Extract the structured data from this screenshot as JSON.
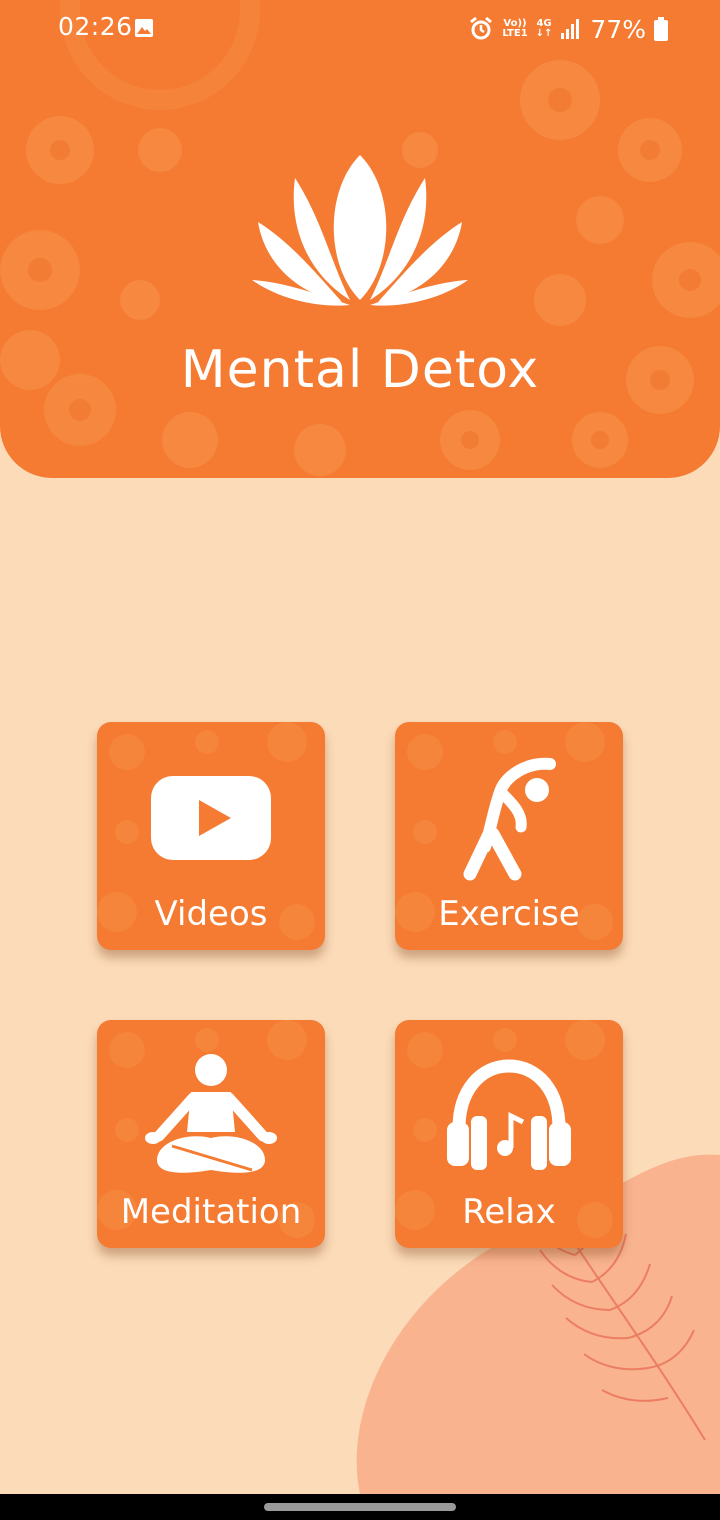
{
  "status_bar": {
    "time": "02:26",
    "network_top": "Vo))",
    "network_bottom": "LTE1",
    "gen_top": "4G",
    "gen_bottom": "↓↑",
    "battery": "77%"
  },
  "header": {
    "title": "Mental Detox",
    "logo_icon": "lotus-icon"
  },
  "tiles": [
    {
      "label": "Videos",
      "icon": "play-video-icon"
    },
    {
      "label": "Exercise",
      "icon": "stretching-person-icon"
    },
    {
      "label": "Meditation",
      "icon": "meditating-person-icon"
    },
    {
      "label": "Relax",
      "icon": "headphones-music-icon"
    }
  ],
  "colors": {
    "accent": "#f47b31",
    "background": "#fcdbb9",
    "decor_blob": "#f9b48f",
    "text": "#ffffff"
  }
}
